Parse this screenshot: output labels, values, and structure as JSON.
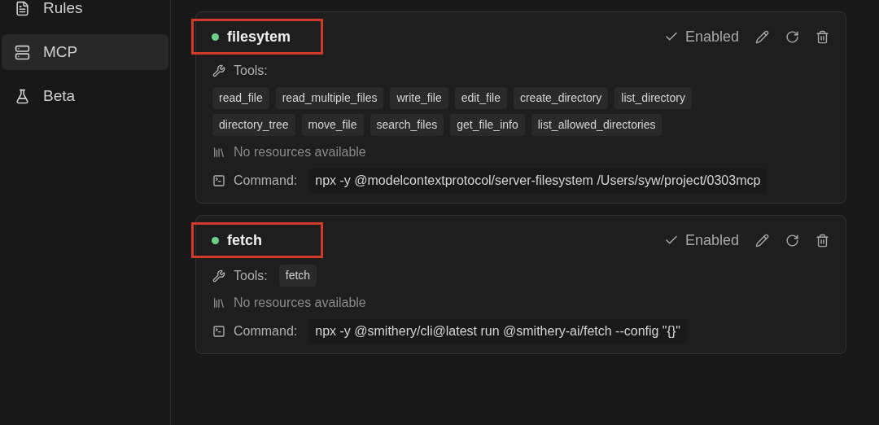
{
  "sidebar": {
    "items": [
      {
        "label": "Rules",
        "selected": false
      },
      {
        "label": "MCP",
        "selected": true
      },
      {
        "label": "Beta",
        "selected": false
      }
    ]
  },
  "servers": [
    {
      "name": "filesytem",
      "highlighted": true,
      "enabled_label": "Enabled",
      "tools_label": "Tools:",
      "tools_inline": false,
      "tools": [
        "read_file",
        "read_multiple_files",
        "write_file",
        "edit_file",
        "create_directory",
        "list_directory",
        "directory_tree",
        "move_file",
        "search_files",
        "get_file_info",
        "list_allowed_directories"
      ],
      "resources": "No resources available",
      "command_label": "Command:",
      "command": "npx -y @modelcontextprotocol/server-filesystem /Users/syw/project/0303mcp"
    },
    {
      "name": "fetch",
      "highlighted": true,
      "enabled_label": "Enabled",
      "tools_label": "Tools:",
      "tools_inline": true,
      "tools": [
        "fetch"
      ],
      "resources": "No resources available",
      "command_label": "Command:",
      "command": "npx -y @smithery/cli@latest run @smithery-ai/fetch --config \"{}\""
    }
  ]
}
